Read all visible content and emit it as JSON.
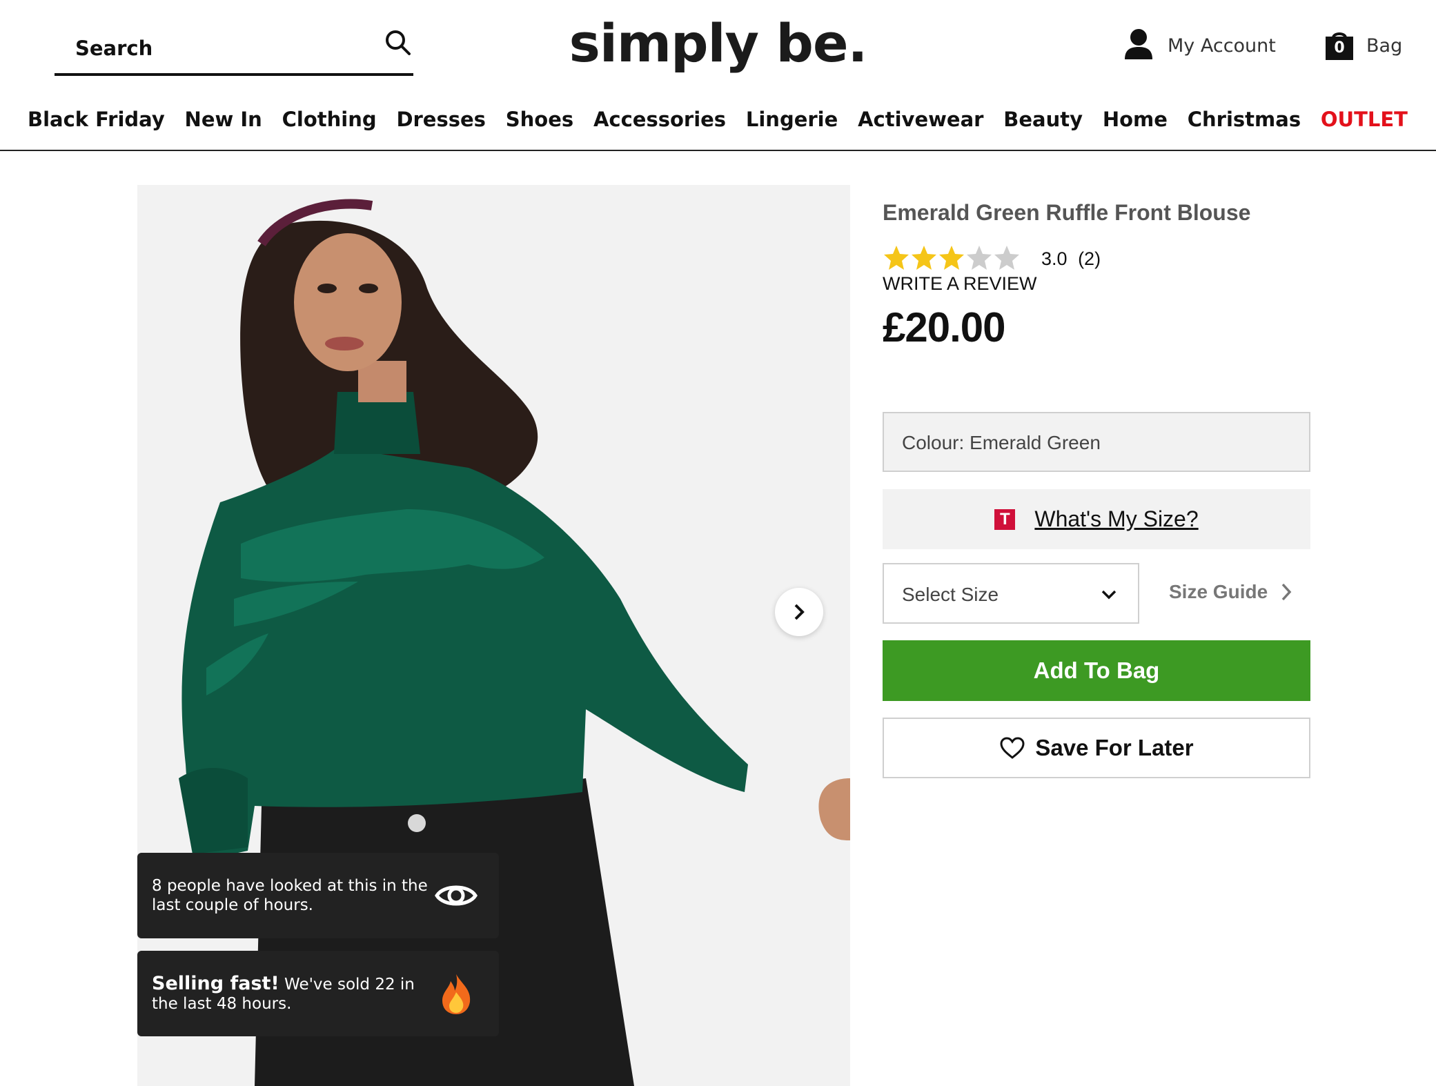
{
  "header": {
    "search": {
      "placeholder": "Search",
      "icon": "search-icon"
    },
    "logo": "simply be.",
    "account": {
      "label": "My Account",
      "icon": "user-icon"
    },
    "bag": {
      "label": "Bag",
      "count": "0",
      "icon": "bag-icon"
    }
  },
  "nav": {
    "items": [
      {
        "label": "Black Friday"
      },
      {
        "label": "New In"
      },
      {
        "label": "Clothing"
      },
      {
        "label": "Dresses"
      },
      {
        "label": "Shoes"
      },
      {
        "label": "Accessories"
      },
      {
        "label": "Lingerie"
      },
      {
        "label": "Activewear"
      },
      {
        "label": "Beauty"
      },
      {
        "label": "Home"
      },
      {
        "label": "Christmas"
      },
      {
        "label": "OUTLET",
        "color": "#e3111b"
      }
    ]
  },
  "gallery": {
    "next_icon": "chevron-right-icon",
    "notices": [
      {
        "text": "8 people have looked at this in the last couple of hours.",
        "icon": "eye-icon"
      },
      {
        "strong": "Selling fast!",
        "text": " We've sold 22 in the last 48 hours.",
        "icon": "fire-icon"
      }
    ]
  },
  "product": {
    "title": "Emerald Green Ruffle Front Blouse",
    "rating": {
      "value": 3.0,
      "max": 5,
      "display": "3.0",
      "count": "(2)"
    },
    "write_review": "WRITE A REVIEW",
    "price": "£20.00",
    "colour": "Colour: Emerald Green",
    "size_help": {
      "badge": "T",
      "label": "What's My Size?"
    },
    "size_select": {
      "selected": "Select Size"
    },
    "size_guide": "Size Guide",
    "add_to_bag": "Add To Bag",
    "save_for_later": "Save For Later"
  },
  "colors": {
    "accent_green": "#3d9a23",
    "outlet_red": "#e3111b",
    "star_gold": "#f5c518",
    "star_grey": "#cccccc",
    "blouse": "#0e5a44"
  }
}
